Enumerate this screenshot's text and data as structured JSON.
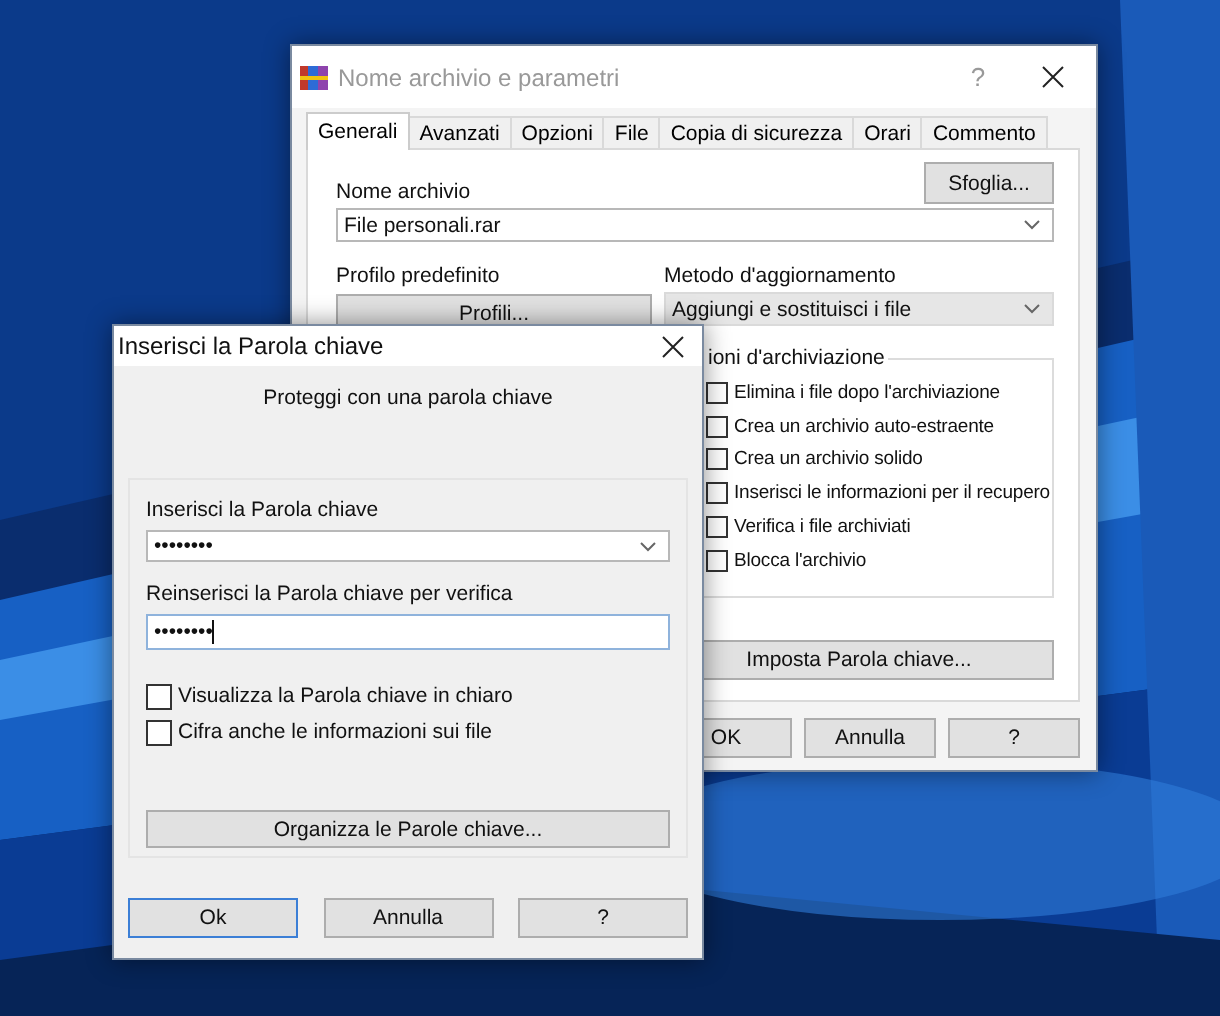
{
  "back_window": {
    "title": "Nome archivio e parametri",
    "help": "?",
    "tabs": [
      {
        "label": "Generali",
        "selected": true
      },
      {
        "label": "Avanzati",
        "selected": false
      },
      {
        "label": "Opzioni",
        "selected": false
      },
      {
        "label": "File",
        "selected": false
      },
      {
        "label": "Copia di sicurezza",
        "selected": false
      },
      {
        "label": "Orari",
        "selected": false
      },
      {
        "label": "Commento",
        "selected": false
      }
    ],
    "archive_name": {
      "label": "Nome archivio",
      "browse": "Sfoglia...",
      "value": "File personali.rar"
    },
    "default_profile": {
      "label": "Profilo predefinito",
      "button": "Profili..."
    },
    "update_method": {
      "label": "Metodo d'aggiornamento",
      "value": "Aggiungi e sostituisci i file"
    },
    "options_group": {
      "label": "ioni d'archiviazione",
      "options": [
        {
          "label": "Elimina i file dopo l'archiviazione",
          "checked": false
        },
        {
          "label": "Crea un archivio auto-estraente",
          "checked": false
        },
        {
          "label": "Crea un archivio solido",
          "checked": false
        },
        {
          "label": "Inserisci le informazioni per il recupero",
          "checked": false
        },
        {
          "label": "Verifica i file archiviati",
          "checked": false
        },
        {
          "label": "Blocca l'archivio",
          "checked": false
        }
      ]
    },
    "set_password": "Imposta Parola chiave...",
    "buttons": [
      "OK",
      "Annulla",
      "?"
    ]
  },
  "password_dialog": {
    "title": "Inserisci la Parola chiave",
    "subtitle": "Proteggi con una parola chiave",
    "password": {
      "label": "Inserisci la Parola chiave",
      "value": "••••••••"
    },
    "confirm": {
      "label": "Reinserisci la Parola chiave per verifica",
      "value": "••••••••"
    },
    "options": [
      {
        "label": "Visualizza la Parola chiave in chiaro",
        "checked": false
      },
      {
        "label": "Cifra anche le informazioni sui file",
        "checked": false
      }
    ],
    "organize": "Organizza le Parole chiave...",
    "buttons": [
      {
        "label": "Ok",
        "selected": true
      },
      {
        "label": "Annulla",
        "selected": false
      },
      {
        "label": "?",
        "selected": false
      }
    ]
  }
}
